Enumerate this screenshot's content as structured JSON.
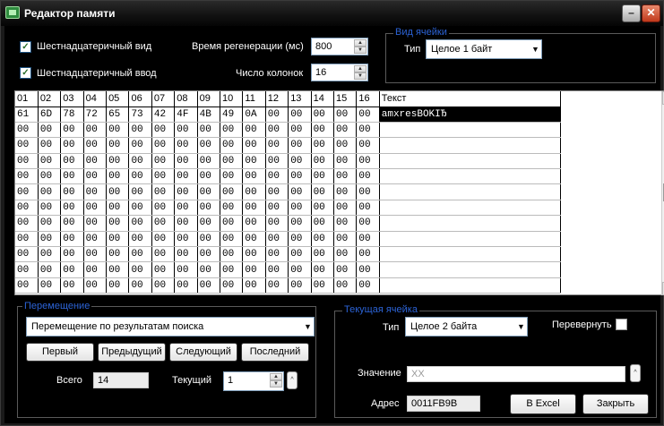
{
  "window": {
    "title": "Редактор памяти"
  },
  "options": {
    "hex_view_label": "Шестнадцатеричный вид",
    "hex_input_label": "Шестнадцатеричный ввод",
    "hex_view_checked": true,
    "hex_input_checked": true,
    "refresh_label": "Время регенерации (мс)",
    "refresh_value": "800",
    "columns_label": "Число колонок",
    "columns_value": "16"
  },
  "cell_view": {
    "group_label": "Вид ячейки",
    "type_label": "Тип",
    "type_value": "Целое 1 байт"
  },
  "grid": {
    "headers": [
      "01",
      "02",
      "03",
      "04",
      "05",
      "06",
      "07",
      "08",
      "09",
      "10",
      "11",
      "12",
      "13",
      "14",
      "15",
      "16",
      "Текст"
    ],
    "rows": [
      [
        "61",
        "6D",
        "78",
        "72",
        "65",
        "73",
        "42",
        "4F",
        "4B",
        "49",
        "0A",
        "00",
        "00",
        "00",
        "00",
        "00",
        "amxresBOKIЂ"
      ],
      [
        "00",
        "00",
        "00",
        "00",
        "00",
        "00",
        "00",
        "00",
        "00",
        "00",
        "00",
        "00",
        "00",
        "00",
        "00",
        "00",
        ""
      ],
      [
        "00",
        "00",
        "00",
        "00",
        "00",
        "00",
        "00",
        "00",
        "00",
        "00",
        "00",
        "00",
        "00",
        "00",
        "00",
        "00",
        ""
      ],
      [
        "00",
        "00",
        "00",
        "00",
        "00",
        "00",
        "00",
        "00",
        "00",
        "00",
        "00",
        "00",
        "00",
        "00",
        "00",
        "00",
        ""
      ],
      [
        "00",
        "00",
        "00",
        "00",
        "00",
        "00",
        "00",
        "00",
        "00",
        "00",
        "00",
        "00",
        "00",
        "00",
        "00",
        "00",
        ""
      ],
      [
        "00",
        "00",
        "00",
        "00",
        "00",
        "00",
        "00",
        "00",
        "00",
        "00",
        "00",
        "00",
        "00",
        "00",
        "00",
        "00",
        ""
      ],
      [
        "00",
        "00",
        "00",
        "00",
        "00",
        "00",
        "00",
        "00",
        "00",
        "00",
        "00",
        "00",
        "00",
        "00",
        "00",
        "00",
        ""
      ],
      [
        "00",
        "00",
        "00",
        "00",
        "00",
        "00",
        "00",
        "00",
        "00",
        "00",
        "00",
        "00",
        "00",
        "00",
        "00",
        "00",
        ""
      ],
      [
        "00",
        "00",
        "00",
        "00",
        "00",
        "00",
        "00",
        "00",
        "00",
        "00",
        "00",
        "00",
        "00",
        "00",
        "00",
        "00",
        ""
      ],
      [
        "00",
        "00",
        "00",
        "00",
        "00",
        "00",
        "00",
        "00",
        "00",
        "00",
        "00",
        "00",
        "00",
        "00",
        "00",
        "00",
        ""
      ],
      [
        "00",
        "00",
        "00",
        "00",
        "00",
        "00",
        "00",
        "00",
        "00",
        "00",
        "00",
        "00",
        "00",
        "00",
        "00",
        "00",
        ""
      ],
      [
        "00",
        "00",
        "00",
        "00",
        "00",
        "00",
        "00",
        "00",
        "00",
        "00",
        "00",
        "00",
        "00",
        "00",
        "00",
        "00",
        ""
      ]
    ]
  },
  "navigation": {
    "group_label": "Перемещение",
    "mode_value": "Перемещение по результатам поиска",
    "first_label": "Первый",
    "prev_label": "Предыдущий",
    "next_label": "Следующий",
    "last_label": "Последний",
    "total_label": "Всего",
    "total_value": "14",
    "current_label": "Текущий",
    "current_value": "1"
  },
  "current_cell": {
    "group_label": "Текущая ячейка",
    "type_label": "Тип",
    "type_value": "Целое 2 байта",
    "flip_label": "Перевернуть",
    "value_label": "Значение",
    "value_placeholder": "XX",
    "address_label": "Адрес",
    "address_value": "0011FB9B",
    "excel_label": "В Excel",
    "close_label": "Закрыть"
  }
}
